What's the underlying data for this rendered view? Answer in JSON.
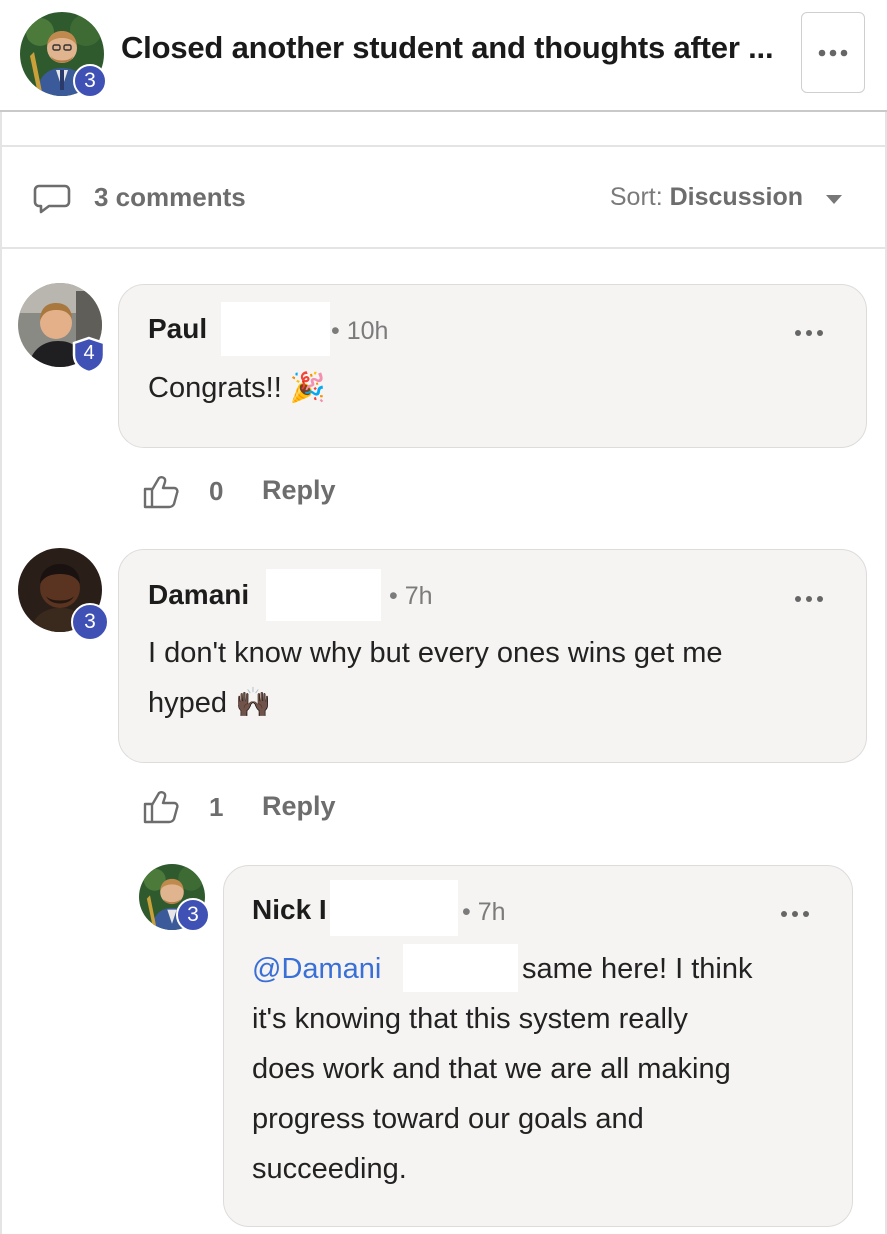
{
  "post": {
    "title": "Closed another student and thoughts after ...",
    "author_level": "3"
  },
  "comments_header": {
    "count_label": "3 comments",
    "sort_prefix": "Sort: ",
    "sort_value": "Discussion"
  },
  "comments": [
    {
      "author": "Paul",
      "level": "4",
      "time": "• 10h",
      "text": "Congrats!! 🎉",
      "likes": "0",
      "reply_label": "Reply"
    },
    {
      "author": "Damani",
      "level": "3",
      "time": "• 7h",
      "text_line1": "I don't know why but every ones wins get me",
      "text_line2": "hyped 🙌🏿",
      "likes": "1",
      "reply_label": "Reply"
    },
    {
      "author": "Nick I",
      "level": "3",
      "time": "• 7h",
      "mention": "@Damani",
      "text_line1": "same here! I think",
      "text_line2": "it's knowing that this system really",
      "text_line3": "does work and that we are all making",
      "text_line4": "progress toward our goals and",
      "text_line5": "succeeding."
    }
  ],
  "colors": {
    "badge": "#3f51b5",
    "mention": "#3a6fd6",
    "bubble": "#f5f4f3"
  },
  "icons": {
    "more": "more-horizontal-icon",
    "comment": "comment-bubble-icon",
    "like": "thumbs-up-icon",
    "sort": "caret-down-icon"
  }
}
